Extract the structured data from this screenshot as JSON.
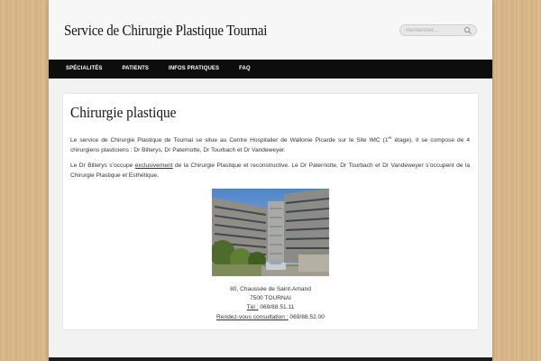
{
  "header": {
    "site_title": "Service de Chirurgie Plastique Tournai",
    "search_placeholder": "Rechercher..."
  },
  "nav": {
    "items": [
      {
        "label": "Spécialités"
      },
      {
        "label": "Patients"
      },
      {
        "label": "Infos pratiques"
      },
      {
        "label": "FAQ"
      }
    ]
  },
  "content": {
    "title": "Chirurgie plastique",
    "para1_a": "Le service de Chirurgie Plastique de Tournai se situe au Centre Hospitalier de Wallonie Picarde sur le Site IMC (1",
    "para1_sup": "er",
    "para1_b": " étage). Il se compose de 4 chirurgiens plasticiens : Dr Bilterys, Dr Paternotte, Dr Tourbach et Dr Vandeweyer.",
    "para2_a": "Le Dr Bilterys s’occupe ",
    "para2_u": "exclusivement",
    "para2_b": " de la Chirurgie Plastique et reconstructive. Le Dr Paternotte, Dr Tourbach et Dr Vandeweyer s’occupent de la Chirurgie  Plastique et Esthétique.",
    "address": {
      "street": "80, Chaussée de Saint-Amand",
      "city": "7500 TOURNAI",
      "tel_label": "Tél :",
      "tel": " 069/88.51.11",
      "rdv_label": "Rendez-vous consultation :",
      "rdv": " 069/88.52.00"
    }
  },
  "colors": {
    "nav_bg": "#0d0d0d",
    "page_bg": "#f2f2f2",
    "wood": "#d9b88a"
  }
}
